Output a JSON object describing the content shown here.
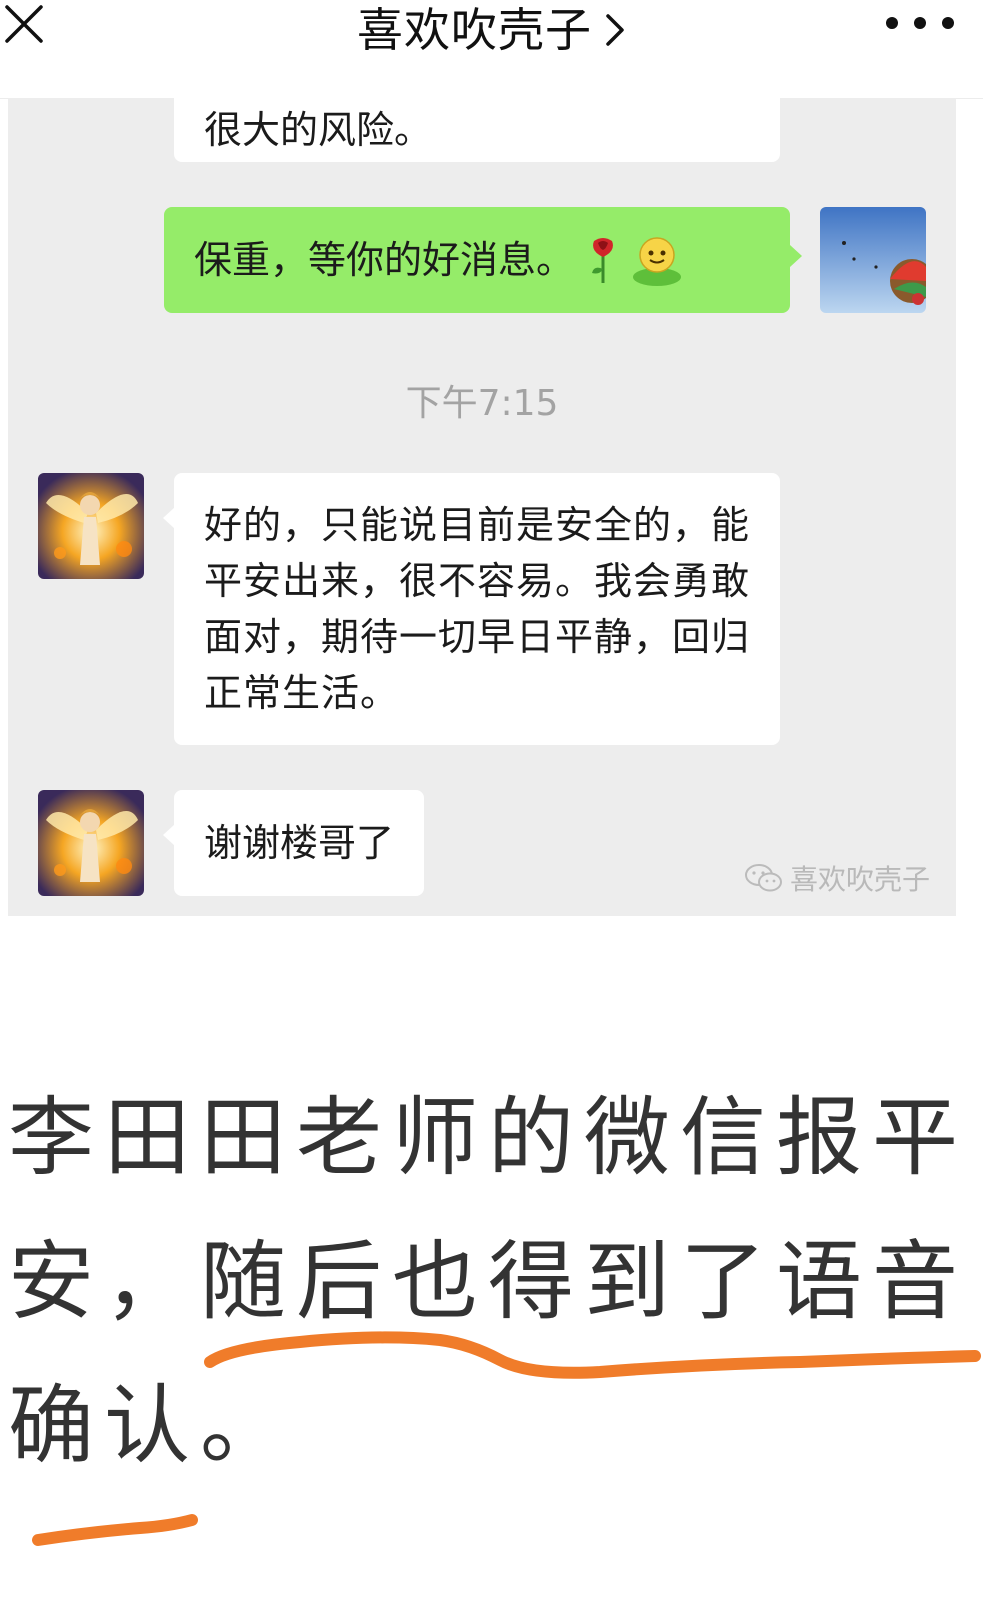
{
  "header": {
    "title": "喜欢吹壳子",
    "close_icon": "close-icon",
    "chevron_icon": "chevron-right-icon",
    "more_icon": "more-dots-icon"
  },
  "chat": {
    "messages": [
      {
        "side": "left",
        "text": "很大的风险。"
      },
      {
        "side": "right",
        "text": "保重，等你的好消息。",
        "emoji": [
          "rose-emoji",
          "smiley-face-emoji"
        ]
      },
      {
        "side": "left",
        "text": "好的，只能说目前是安全的，能平安出来，很不容易。我会勇敢面对，期待一切早日平静，回归正常生活。"
      },
      {
        "side": "left",
        "text": "谢谢楼哥了"
      }
    ],
    "timestamp": "下午7:15",
    "watermark": "喜欢吹壳子",
    "bubble_colors": {
      "sent": "#95ec69",
      "received": "#ffffff",
      "background": "#ededed"
    }
  },
  "caption": {
    "text": "李田田老师的微信报平安，随后也得到了语音确认。",
    "underline_color": "#f07c2a"
  }
}
